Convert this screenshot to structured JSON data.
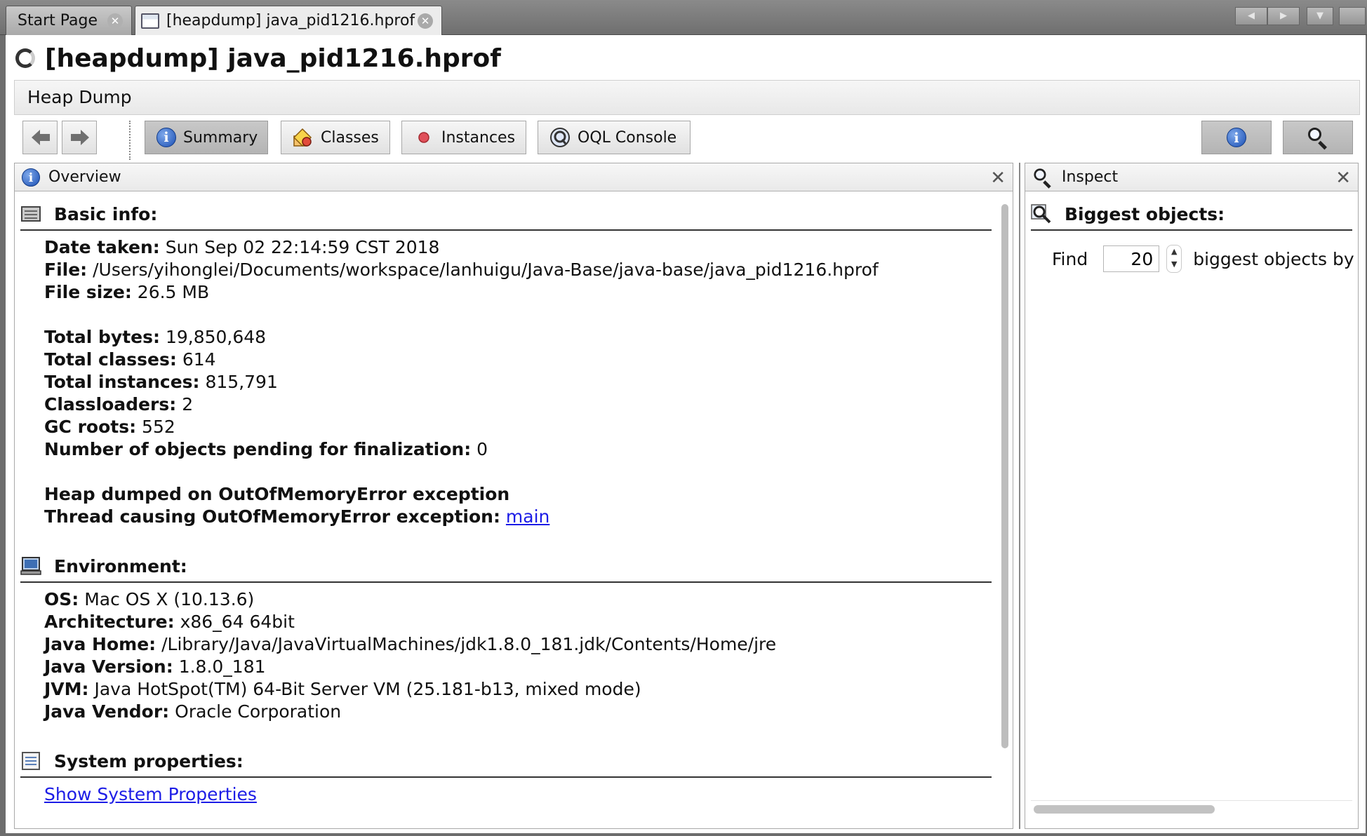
{
  "tabs": [
    {
      "label": "Start Page",
      "active": false
    },
    {
      "label": "[heapdump] java_pid1216.hprof",
      "active": true
    }
  ],
  "window": {
    "title": "[heapdump] java_pid1216.hprof"
  },
  "heap_dump_label": "Heap Dump",
  "toolbar": {
    "summary_label": "Summary",
    "classes_label": "Classes",
    "instances_label": "Instances",
    "oql_label": "OQL Console",
    "selected": "Summary"
  },
  "overview": {
    "title": "Overview",
    "basic_info": {
      "heading": "Basic info:",
      "date_taken_label": "Date taken:",
      "date_taken": "Sun Sep 02 22:14:59 CST 2018",
      "file_label": "File:",
      "file": "/Users/yihonglei/Documents/workspace/lanhuigu/Java-Base/java-base/java_pid1216.hprof",
      "file_size_label": "File size:",
      "file_size": "26.5 MB",
      "total_bytes_label": "Total bytes:",
      "total_bytes": "19,850,648",
      "total_classes_label": "Total classes:",
      "total_classes": "614",
      "total_instances_label": "Total instances:",
      "total_instances": "815,791",
      "classloaders_label": "Classloaders:",
      "classloaders": "2",
      "gc_roots_label": "GC roots:",
      "gc_roots": "552",
      "pending_label": "Number of objects pending for finalization:",
      "pending": "0",
      "oom_line": "Heap dumped on OutOfMemoryError exception",
      "thread_label": "Thread causing OutOfMemoryError exception:",
      "thread_link": "main"
    },
    "environment": {
      "heading": "Environment:",
      "os_label": "OS:",
      "os": "Mac OS X (10.13.6)",
      "arch_label": "Architecture:",
      "arch": "x86_64 64bit",
      "java_home_label": "Java Home:",
      "java_home": "/Library/Java/JavaVirtualMachines/jdk1.8.0_181.jdk/Contents/Home/jre",
      "java_version_label": "Java Version:",
      "java_version": "1.8.0_181",
      "jvm_label": "JVM:",
      "jvm": "Java HotSpot(TM) 64-Bit Server VM (25.181-b13, mixed mode)",
      "vendor_label": "Java Vendor:",
      "vendor": "Oracle Corporation"
    },
    "system_properties": {
      "heading": "System properties:",
      "link": "Show System Properties"
    }
  },
  "inspect": {
    "title": "Inspect",
    "heading": "Biggest objects:",
    "find_label": "Find",
    "find_value": "20",
    "suffix": "biggest objects by"
  },
  "colors": {
    "link": "#1c1ce6",
    "selected_button": "#bebebe",
    "tabbar": "#7a7a7a"
  }
}
